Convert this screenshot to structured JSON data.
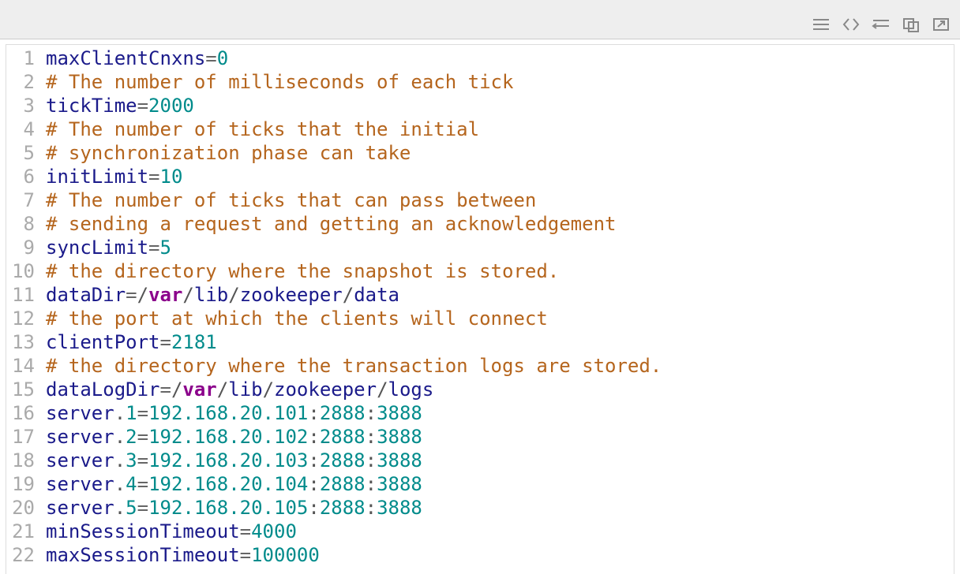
{
  "toolbar": {
    "icons": [
      "menu-icon",
      "code-icon",
      "wrap-icon",
      "copy-icon",
      "popout-icon"
    ]
  },
  "code": {
    "lineNumbers": [
      "1",
      "2",
      "3",
      "4",
      "5",
      "6",
      "7",
      "8",
      "9",
      "10",
      "11",
      "12",
      "13",
      "14",
      "15",
      "16",
      "17",
      "18",
      "19",
      "20",
      "21",
      "22"
    ],
    "lines": [
      [
        [
          "key",
          "maxClientCnxns"
        ],
        [
          "op",
          "="
        ],
        [
          "num",
          "0"
        ]
      ],
      [
        [
          "comment",
          "# The number of milliseconds of each tick"
        ]
      ],
      [
        [
          "key",
          "tickTime"
        ],
        [
          "op",
          "="
        ],
        [
          "num",
          "2000"
        ]
      ],
      [
        [
          "comment",
          "# The number of ticks that the initial"
        ]
      ],
      [
        [
          "comment",
          "# synchronization phase can take"
        ]
      ],
      [
        [
          "key",
          "initLimit"
        ],
        [
          "op",
          "="
        ],
        [
          "num",
          "10"
        ]
      ],
      [
        [
          "comment",
          "# The number of ticks that can pass between"
        ]
      ],
      [
        [
          "comment",
          "# sending a request and getting an acknowledgement"
        ]
      ],
      [
        [
          "key",
          "syncLimit"
        ],
        [
          "op",
          "="
        ],
        [
          "num",
          "5"
        ]
      ],
      [
        [
          "comment",
          "# the directory where the snapshot is stored."
        ]
      ],
      [
        [
          "key",
          "dataDir"
        ],
        [
          "op",
          "="
        ],
        [
          "sep",
          "/"
        ],
        [
          "var",
          "var"
        ],
        [
          "sep",
          "/"
        ],
        [
          "path",
          "lib"
        ],
        [
          "sep",
          "/"
        ],
        [
          "path",
          "zookeeper"
        ],
        [
          "sep",
          "/"
        ],
        [
          "path",
          "data"
        ]
      ],
      [
        [
          "comment",
          "# the port at which the clients will connect"
        ]
      ],
      [
        [
          "key",
          "clientPort"
        ],
        [
          "op",
          "="
        ],
        [
          "num",
          "2181"
        ]
      ],
      [
        [
          "comment",
          "# the directory where the transaction logs are stored."
        ]
      ],
      [
        [
          "key",
          "dataLogDir"
        ],
        [
          "op",
          "="
        ],
        [
          "sep",
          "/"
        ],
        [
          "var",
          "var"
        ],
        [
          "sep",
          "/"
        ],
        [
          "path",
          "lib"
        ],
        [
          "sep",
          "/"
        ],
        [
          "path",
          "zookeeper"
        ],
        [
          "sep",
          "/"
        ],
        [
          "path",
          "logs"
        ]
      ],
      [
        [
          "key",
          "server"
        ],
        [
          "dot",
          "."
        ],
        [
          "num",
          "1"
        ],
        [
          "op",
          "="
        ],
        [
          "num",
          "192.168.20.101"
        ],
        [
          "sep",
          ":"
        ],
        [
          "num",
          "2888"
        ],
        [
          "sep",
          ":"
        ],
        [
          "num",
          "3888"
        ]
      ],
      [
        [
          "key",
          "server"
        ],
        [
          "dot",
          "."
        ],
        [
          "num",
          "2"
        ],
        [
          "op",
          "="
        ],
        [
          "num",
          "192.168.20.102"
        ],
        [
          "sep",
          ":"
        ],
        [
          "num",
          "2888"
        ],
        [
          "sep",
          ":"
        ],
        [
          "num",
          "3888"
        ]
      ],
      [
        [
          "key",
          "server"
        ],
        [
          "dot",
          "."
        ],
        [
          "num",
          "3"
        ],
        [
          "op",
          "="
        ],
        [
          "num",
          "192.168.20.103"
        ],
        [
          "sep",
          ":"
        ],
        [
          "num",
          "2888"
        ],
        [
          "sep",
          ":"
        ],
        [
          "num",
          "3888"
        ]
      ],
      [
        [
          "key",
          "server"
        ],
        [
          "dot",
          "."
        ],
        [
          "num",
          "4"
        ],
        [
          "op",
          "="
        ],
        [
          "num",
          "192.168.20.104"
        ],
        [
          "sep",
          ":"
        ],
        [
          "num",
          "2888"
        ],
        [
          "sep",
          ":"
        ],
        [
          "num",
          "3888"
        ]
      ],
      [
        [
          "key",
          "server"
        ],
        [
          "dot",
          "."
        ],
        [
          "num",
          "5"
        ],
        [
          "op",
          "="
        ],
        [
          "num",
          "192.168.20.105"
        ],
        [
          "sep",
          ":"
        ],
        [
          "num",
          "2888"
        ],
        [
          "sep",
          ":"
        ],
        [
          "num",
          "3888"
        ]
      ],
      [
        [
          "key",
          "minSessionTimeout"
        ],
        [
          "op",
          "="
        ],
        [
          "num",
          "4000"
        ]
      ],
      [
        [
          "key",
          "maxSessionTimeout"
        ],
        [
          "op",
          "="
        ],
        [
          "num",
          "100000"
        ]
      ]
    ]
  }
}
